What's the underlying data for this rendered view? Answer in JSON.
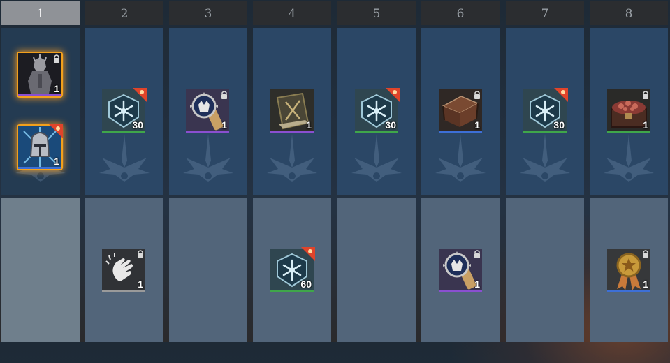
{
  "columns": [
    {
      "label": "1"
    },
    {
      "label": "2"
    },
    {
      "label": "3"
    },
    {
      "label": "4"
    },
    {
      "label": "5"
    },
    {
      "label": "6"
    },
    {
      "label": "7"
    },
    {
      "label": "8"
    }
  ],
  "active_column": "1",
  "items": {
    "c1_top_a": {
      "icon": "armored-knight-portrait-icon",
      "qty": "1",
      "rarity_color": "#8a4fd0"
    },
    "c1_top_b": {
      "icon": "knight-helmet-icon",
      "qty": "1",
      "rarity_color": "#3d6fd6"
    },
    "c2_top": {
      "icon": "rune-emblem-icon",
      "qty": "30",
      "rarity_color": "#3fa64a"
    },
    "c3_top": {
      "icon": "seal-scroll-icon",
      "qty": "1",
      "rarity_color": "#8a4fd0"
    },
    "c4_top": {
      "icon": "sword-book-icon",
      "qty": "1",
      "rarity_color": "#8a4fd0"
    },
    "c5_top": {
      "icon": "rune-emblem-icon",
      "qty": "30",
      "rarity_color": "#3fa64a"
    },
    "c6_top": {
      "icon": "treasure-chest-icon",
      "qty": "1",
      "rarity_color": "#3d6fd6"
    },
    "c7_top": {
      "icon": "rune-emblem-icon",
      "qty": "30",
      "rarity_color": "#3fa64a"
    },
    "c8_top": {
      "icon": "gem-chest-icon",
      "qty": "1",
      "rarity_color": "#3fa64a"
    },
    "c2_bot": {
      "icon": "clapping-hands-icon",
      "qty": "1",
      "rarity_color": "#9a9a9a"
    },
    "c4_bot": {
      "icon": "rune-emblem-icon",
      "qty": "60",
      "rarity_color": "#3fa64a"
    },
    "c6_bot": {
      "icon": "seal-scroll-icon",
      "qty": "1",
      "rarity_color": "#8a4fd0"
    },
    "c8_bot": {
      "icon": "gold-medal-icon",
      "qty": "1",
      "rarity_color": "#3d6fd6"
    }
  },
  "colors": {
    "highlight_glow": "#f2a01c",
    "tag_red": "#e0442a"
  }
}
